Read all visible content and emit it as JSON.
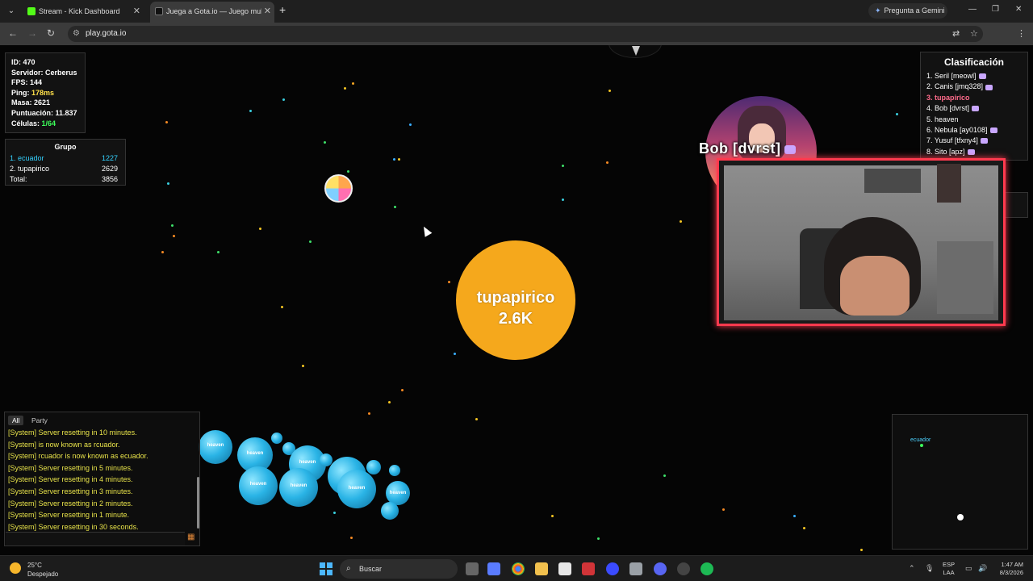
{
  "browser": {
    "tabs": [
      {
        "title": "Stream - Kick Dashboard",
        "favicon_color": "#53fc18"
      },
      {
        "title": "Juega a Gota.io — Juego multij",
        "favicon_color": "#111111"
      }
    ],
    "new_tab_label": "+",
    "gemini_label": "Pregunta a Gemini",
    "url": "play.gota.io"
  },
  "stats": {
    "id": "ID: 470",
    "server": "Servidor: Cerberus",
    "fps": "FPS: 144",
    "ping_label": "Ping: ",
    "ping_value": "178ms",
    "mass": "Masa: 2621",
    "score": "Puntuación: 11.837",
    "cells_label": "Células: ",
    "cells_value": "1/64"
  },
  "group": {
    "title": "Grupo",
    "rows": [
      {
        "name": "1. ecuador",
        "value": "1227"
      },
      {
        "name": "2. tupapirico",
        "value": "2629"
      },
      {
        "name": "Total:",
        "value": "3856"
      }
    ]
  },
  "leaderboard": {
    "title": "Clasificación",
    "entries": [
      "1. Seril [meowl]",
      "2. Canis [jmq328]",
      "3. tupapirico",
      "4. Bob [dvrst]",
      "5. heaven",
      "6. Nebula [ay0108]",
      "7. Yusuf [tfxny4]",
      "8. Sito [apz]"
    ]
  },
  "game": {
    "player_name": "tupapirico",
    "player_mass": "2.6K",
    "enemy_name": "Bob [dvrst]",
    "blue_cell_label": "heaven",
    "colors": {
      "player": "#f5a81c",
      "accent": "#ff3a4e"
    }
  },
  "chat": {
    "tabs": [
      "All",
      "Party"
    ],
    "messages": [
      "[System] Server resetting in 10 minutes.",
      "[System] is now known as rcuador.",
      "[System] rcuador is now known as ecuador.",
      "[System] Server resetting in 5 minutes.",
      "[System] Server resetting in 4 minutes.",
      "[System] Server resetting in 3 minutes.",
      "[System] Server resetting in 2 minutes.",
      "[System] Server resetting in 1 minute.",
      "[System] Server resetting in 30 seconds."
    ]
  },
  "minimap": {
    "label": "ecuador"
  },
  "taskbar": {
    "temp": "25°C",
    "weather": "Despejado",
    "search_label": "Buscar",
    "lang1": "ESP",
    "lang2": "LAA",
    "time": "1:47 AM",
    "date": "8/3/2026"
  }
}
